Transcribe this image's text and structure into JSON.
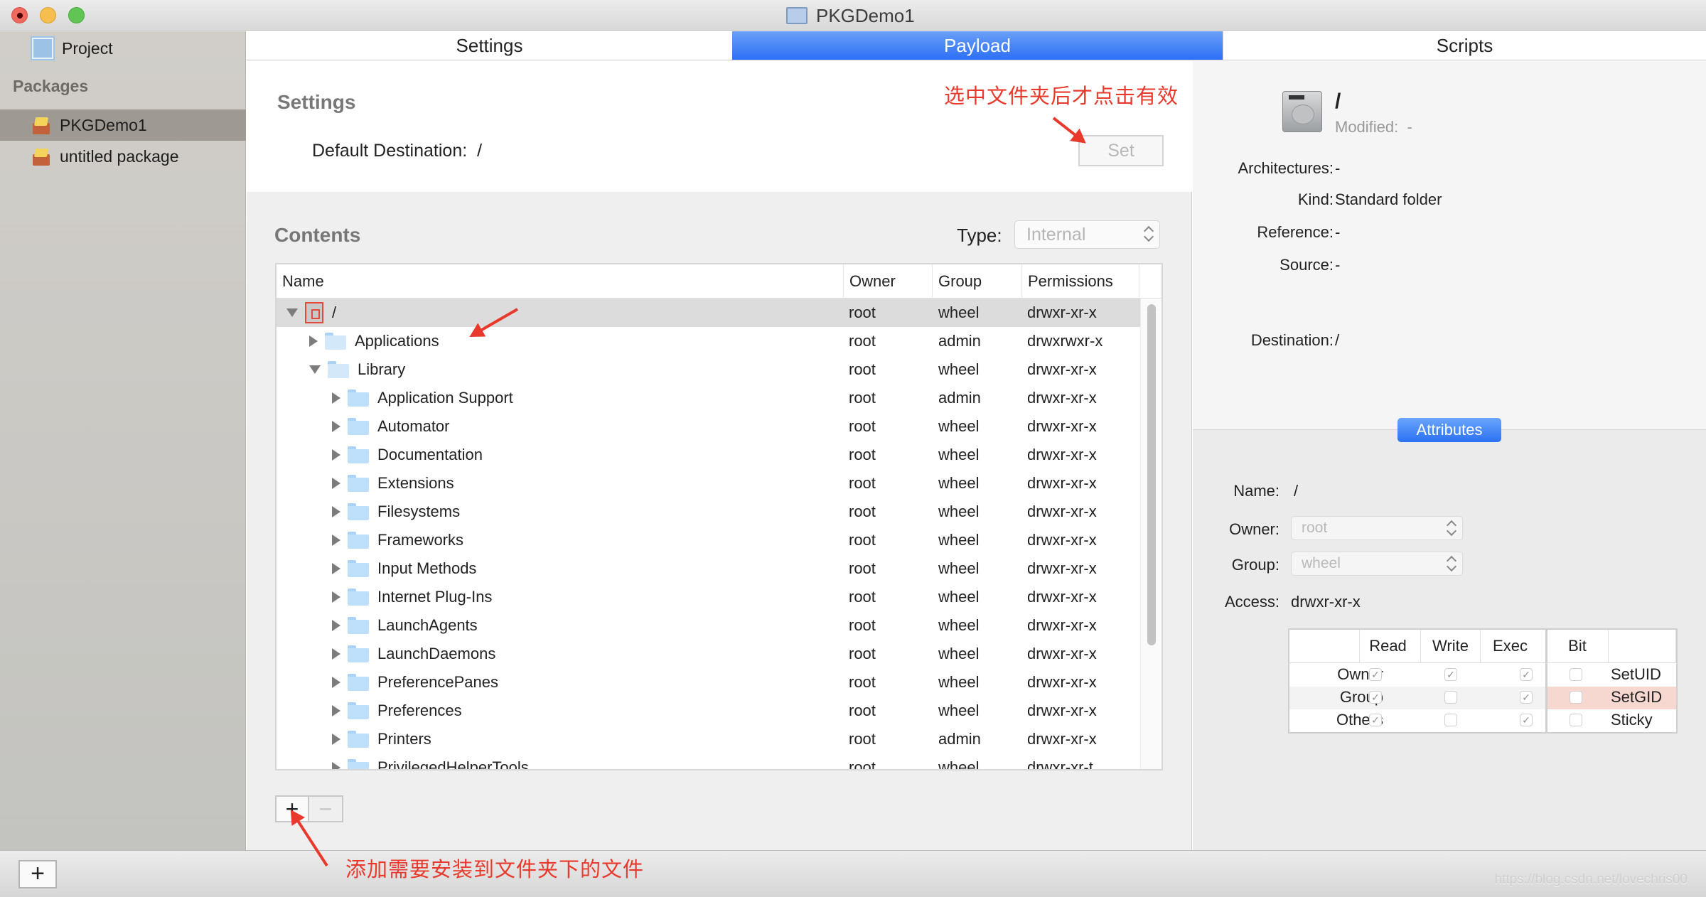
{
  "window": {
    "title": "PKGDemo1",
    "controls": [
      "close",
      "minimize",
      "zoom"
    ]
  },
  "sidebar": {
    "project_label": "Project",
    "section_label": "Packages",
    "items": [
      {
        "label": "PKGDemo1",
        "icon": "package-icon",
        "selected": true
      },
      {
        "label": "untitled package",
        "icon": "package-icon",
        "selected": false
      }
    ],
    "add_button": "+"
  },
  "tabs": [
    {
      "label": "Settings",
      "active": false
    },
    {
      "label": "Payload",
      "active": true
    },
    {
      "label": "Scripts",
      "active": false
    }
  ],
  "payload": {
    "settings_heading": "Settings",
    "default_destination_label": "Default Destination:",
    "default_destination_value": "/",
    "set_button": "Set",
    "contents_heading": "Contents",
    "type_label": "Type:",
    "type_value": "Internal",
    "columns": [
      "Name",
      "Owner",
      "Group",
      "Permissions"
    ],
    "rows": [
      {
        "name": "/",
        "owner": "root",
        "group": "wheel",
        "perm": "drwxr-xr-x",
        "depth": 0,
        "state": "open",
        "icon": "root-disk-icon",
        "selected": true
      },
      {
        "name": "Applications",
        "owner": "root",
        "group": "admin",
        "perm": "drwxrwxr-x",
        "depth": 1,
        "state": "closed",
        "icon": "applications-folder-icon"
      },
      {
        "name": "Library",
        "owner": "root",
        "group": "wheel",
        "perm": "drwxr-xr-x",
        "depth": 1,
        "state": "open",
        "icon": "library-folder-icon"
      },
      {
        "name": "Application Support",
        "owner": "root",
        "group": "admin",
        "perm": "drwxr-xr-x",
        "depth": 2,
        "state": "closed",
        "icon": "folder-icon"
      },
      {
        "name": "Automator",
        "owner": "root",
        "group": "wheel",
        "perm": "drwxr-xr-x",
        "depth": 2,
        "state": "closed",
        "icon": "folder-icon"
      },
      {
        "name": "Documentation",
        "owner": "root",
        "group": "wheel",
        "perm": "drwxr-xr-x",
        "depth": 2,
        "state": "closed",
        "icon": "folder-icon"
      },
      {
        "name": "Extensions",
        "owner": "root",
        "group": "wheel",
        "perm": "drwxr-xr-x",
        "depth": 2,
        "state": "closed",
        "icon": "folder-icon"
      },
      {
        "name": "Filesystems",
        "owner": "root",
        "group": "wheel",
        "perm": "drwxr-xr-x",
        "depth": 2,
        "state": "closed",
        "icon": "folder-icon"
      },
      {
        "name": "Frameworks",
        "owner": "root",
        "group": "wheel",
        "perm": "drwxr-xr-x",
        "depth": 2,
        "state": "closed",
        "icon": "folder-icon"
      },
      {
        "name": "Input Methods",
        "owner": "root",
        "group": "wheel",
        "perm": "drwxr-xr-x",
        "depth": 2,
        "state": "closed",
        "icon": "folder-icon"
      },
      {
        "name": "Internet Plug-Ins",
        "owner": "root",
        "group": "wheel",
        "perm": "drwxr-xr-x",
        "depth": 2,
        "state": "closed",
        "icon": "folder-icon"
      },
      {
        "name": "LaunchAgents",
        "owner": "root",
        "group": "wheel",
        "perm": "drwxr-xr-x",
        "depth": 2,
        "state": "closed",
        "icon": "folder-icon"
      },
      {
        "name": "LaunchDaemons",
        "owner": "root",
        "group": "wheel",
        "perm": "drwxr-xr-x",
        "depth": 2,
        "state": "closed",
        "icon": "folder-icon"
      },
      {
        "name": "PreferencePanes",
        "owner": "root",
        "group": "wheel",
        "perm": "drwxr-xr-x",
        "depth": 2,
        "state": "closed",
        "icon": "folder-icon"
      },
      {
        "name": "Preferences",
        "owner": "root",
        "group": "wheel",
        "perm": "drwxr-xr-x",
        "depth": 2,
        "state": "closed",
        "icon": "folder-icon"
      },
      {
        "name": "Printers",
        "owner": "root",
        "group": "admin",
        "perm": "drwxr-xr-x",
        "depth": 2,
        "state": "closed",
        "icon": "folder-icon"
      },
      {
        "name": "PrivilegedHelperTools",
        "owner": "root",
        "group": "wheel",
        "perm": "drwxr-xr-t",
        "depth": 2,
        "state": "closed",
        "icon": "folder-icon"
      }
    ],
    "add_item_button": "+",
    "remove_item_button": "−"
  },
  "inspector": {
    "name": "/",
    "modified_label": "Modified:",
    "modified_value": "-",
    "fields": [
      {
        "label": "Architectures:",
        "value": "-"
      },
      {
        "label": "Kind:",
        "value": "Standard folder"
      },
      {
        "label": "Reference:",
        "value": "-"
      },
      {
        "label": "Source:",
        "value": "-"
      },
      {
        "label": "Destination:",
        "value": "/"
      }
    ],
    "attributes_button": "Attributes",
    "attr": {
      "name_label": "Name:",
      "name_value": "/",
      "owner_label": "Owner:",
      "owner_value": "root",
      "group_label": "Group:",
      "group_value": "wheel",
      "access_label": "Access:",
      "access_value": "drwxr-xr-x"
    },
    "permissions": {
      "columns": [
        "Read",
        "Write",
        "Exec"
      ],
      "bit_column": "Bit",
      "rows": [
        {
          "label": "Owner",
          "read": true,
          "write": true,
          "exec": true,
          "bit_label": "SetUID",
          "bit": false
        },
        {
          "label": "Group",
          "read": true,
          "write": false,
          "exec": true,
          "bit_label": "SetGID",
          "bit": false,
          "highlight": true
        },
        {
          "label": "Others",
          "read": true,
          "write": false,
          "exec": true,
          "bit_label": "Sticky",
          "bit": false
        }
      ]
    }
  },
  "annotations": {
    "set_hint": "选中文件夹后才点击有效",
    "add_hint": "添加需要安装到文件夹下的文件",
    "color": "#e8392c"
  },
  "watermark": "https://blog.csdn.net/lovechris00",
  "colors": {
    "accent": "#2c6ff6",
    "sidebar_selected": "#9e9992",
    "setgid_highlight": "#f6d8d1"
  }
}
